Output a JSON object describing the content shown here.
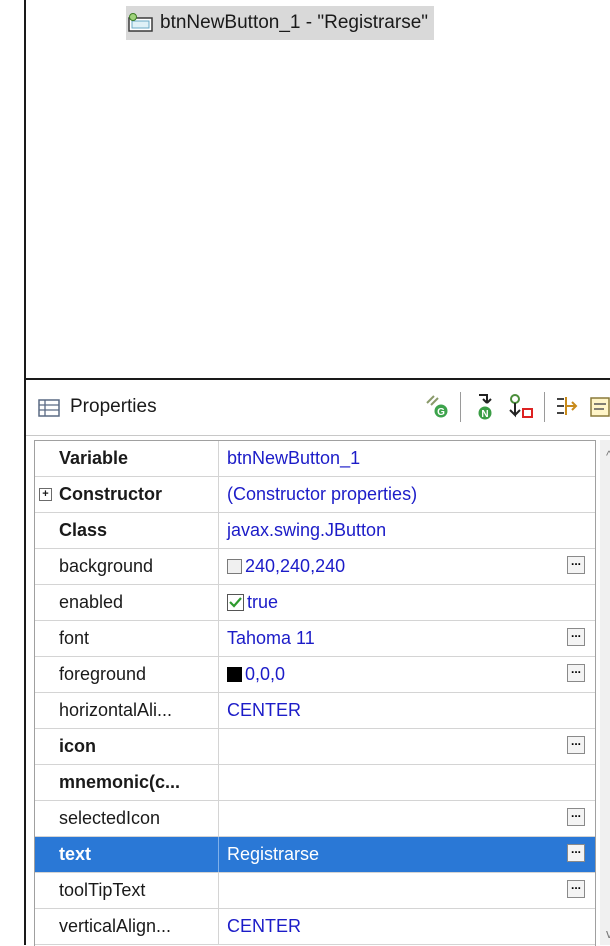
{
  "tree": {
    "node_label": "btnNewButton_1 - \"Registrarse\"",
    "node_icon": "jbutton-component-icon"
  },
  "properties": {
    "title": "Properties",
    "toolbar_icons": [
      "show-events-icon",
      "goto-definition-icon",
      "convert-local-to-field-icon",
      "show-advanced-properties-icon",
      "default-value-icon"
    ],
    "rows": [
      {
        "name": "Variable",
        "value": "btnNewButton_1",
        "bold": true
      },
      {
        "name": "Constructor",
        "value": "(Constructor properties)",
        "bold": true,
        "expandable": true,
        "expand_symbol": "+"
      },
      {
        "name": "Class",
        "value": "javax.swing.JButton",
        "bold": true
      },
      {
        "name": "background",
        "value": "240,240,240",
        "swatch": "#f0f0f0",
        "ellipsis": true
      },
      {
        "name": "enabled",
        "value": "true",
        "checkbox": true
      },
      {
        "name": "font",
        "value": "Tahoma 11",
        "ellipsis": true
      },
      {
        "name": "foreground",
        "value": "0,0,0",
        "swatch": "#000000",
        "ellipsis": true
      },
      {
        "name": "horizontalAli...",
        "value": "CENTER"
      },
      {
        "name": "icon",
        "value": "",
        "bold": true,
        "ellipsis": true
      },
      {
        "name": "mnemonic(c...",
        "value": "",
        "bold": true
      },
      {
        "name": "selectedIcon",
        "value": "",
        "ellipsis": true
      },
      {
        "name": "text",
        "value": "Registrarse",
        "bold": true,
        "ellipsis": true,
        "selected": true
      },
      {
        "name": "toolTipText",
        "value": "",
        "ellipsis": true
      },
      {
        "name": "verticalAlign...",
        "value": "CENTER"
      }
    ],
    "ellipsis_label": "...",
    "selection_color": "#2a78d6",
    "value_color": "#1c1cc8"
  }
}
